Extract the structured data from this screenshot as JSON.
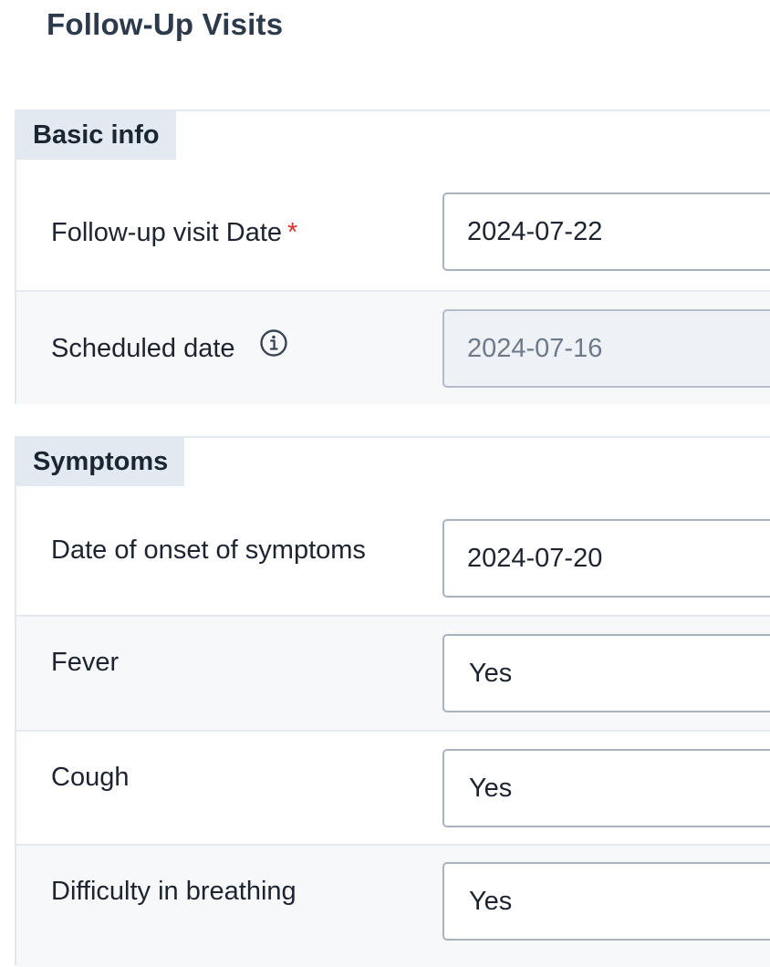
{
  "page": {
    "title": "Follow-Up Visits"
  },
  "basic_info": {
    "header": "Basic info",
    "follow_up_date": {
      "label": "Follow-up visit Date",
      "required_marker": "*",
      "value": "2024-07-22"
    },
    "scheduled_date": {
      "label": "Scheduled date",
      "icon": "info-icon",
      "value": "2024-07-16"
    }
  },
  "symptoms": {
    "header": "Symptoms",
    "onset_date": {
      "label": "Date of onset of symptoms",
      "value": "2024-07-20"
    },
    "fever": {
      "label": "Fever",
      "value": "Yes"
    },
    "cough": {
      "label": "Cough",
      "value": "Yes"
    },
    "difficulty_breathing": {
      "label": "Difficulty in breathing",
      "value": "Yes"
    }
  },
  "colors": {
    "section_header_bg": "#e3e9f1",
    "required": "#d9322b",
    "alt_row_bg": "#f7f8fa",
    "field_border": "#a9b3c0"
  }
}
